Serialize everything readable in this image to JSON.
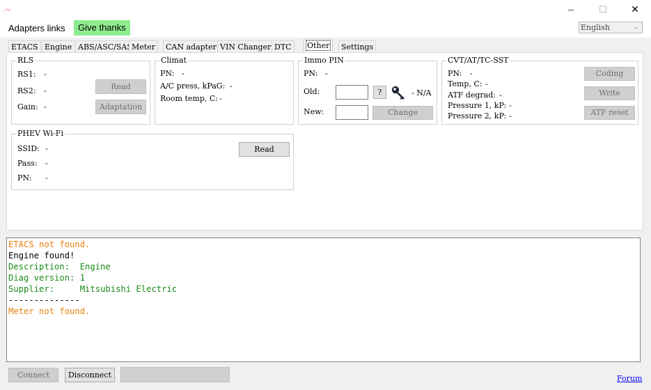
{
  "window": {
    "minimize_glyph": "—",
    "maximize_glyph": "☐",
    "close_glyph": "✕",
    "app_icon": "app-icon"
  },
  "menu": {
    "adapters_links": "Adapters links",
    "give_thanks": "Give thanks",
    "language": "English",
    "give_thanks_color": "#8fec8f"
  },
  "tabs": [
    "ETACS",
    "Engine",
    "ABS/ASC/SAS",
    "Meter",
    "CAN adapter",
    "VIN Changer",
    "DTC",
    "Other",
    "Settings"
  ],
  "active_tab": "Other",
  "rls": {
    "title": "RLS",
    "rs1_label": "RS1:",
    "rs1_value": "-",
    "rs2_label": "RS2:",
    "rs2_value": "-",
    "gain_label": "Gain:",
    "gain_value": "-",
    "read_button": "Read",
    "adaptation_button": "Adaptation"
  },
  "climat": {
    "title": "Climat",
    "pn_label": "PN:",
    "pn_value": "-",
    "ac_label": "A/C press, kPaG:",
    "ac_value": "-",
    "room_label": "Room temp, C:",
    "room_value": "-"
  },
  "immo": {
    "title": "Immo PIN",
    "pn_label": "PN:",
    "pn_value": "-",
    "old_label": "Old:",
    "new_label": "New:",
    "help_button": "?",
    "key_icon": "key-icon",
    "status_value": "- N/A",
    "change_button": "Change"
  },
  "cvt": {
    "title": "CVT/AT/TC-SST",
    "pn_label": "PN:",
    "pn_value": "-",
    "temp_label": "Temp, C:",
    "temp_value": "-",
    "atf_label": "ATF degrad:",
    "atf_value": "-",
    "p1_label": "Pressure 1, kP:",
    "p1_value": "-",
    "p2_label": "Pressure 2, kP:",
    "p2_value": "-",
    "coding_button": "Coding",
    "write_button": "Write",
    "atf_reset_button": "ATF reset"
  },
  "phev": {
    "title": "PHEV Wi-Fi",
    "ssid_label": "SSID:",
    "ssid_value": "-",
    "pass_label": "Pass:",
    "pass_value": "-",
    "pn_label": "PN:",
    "pn_value": "-",
    "read_button": "Read"
  },
  "log": {
    "colors": {
      "warning": "#e8820c",
      "info": "#000000",
      "success": "#1a8a1a"
    },
    "lines": [
      {
        "text": "ETACS not found.",
        "kind": "warning"
      },
      {
        "text": "Engine found!",
        "kind": "info"
      },
      {
        "text": "Description:  Engine",
        "kind": "success"
      },
      {
        "text": "Diag version: 1",
        "kind": "success"
      },
      {
        "text": "Supplier:     Mitsubishi Electric",
        "kind": "success"
      },
      {
        "text": "--------------",
        "kind": "info"
      },
      {
        "text": "Meter not found.",
        "kind": "warning"
      }
    ]
  },
  "status": {
    "connect_button": "Connect",
    "disconnect_button": "Disconnect",
    "status_field_value": "",
    "forum_link": "Forum"
  }
}
